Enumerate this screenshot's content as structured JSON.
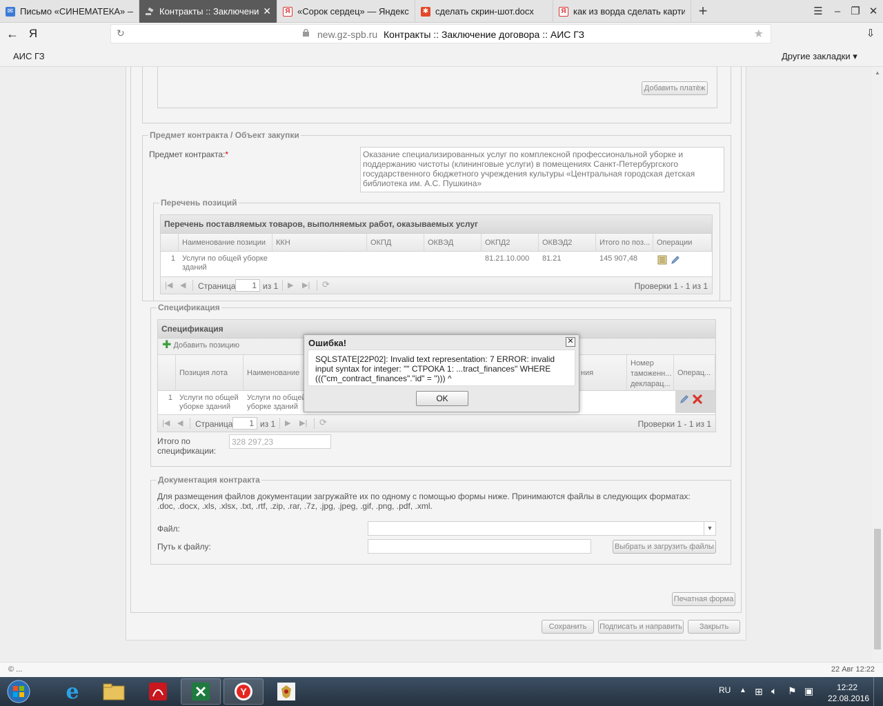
{
  "browser": {
    "tabs": [
      {
        "label": "Письмо «СИНЕМАТЕКА» —",
        "icon": "mail-icon"
      },
      {
        "label": "Контракты :: Заключение",
        "icon": "gavel-icon"
      },
      {
        "label": "«Сорок сердец» — Яндекс",
        "icon": "yandex-icon"
      },
      {
        "label": "сделать скрин-шот.docx",
        "icon": "document-icon"
      },
      {
        "label": "как из ворда сделать карти",
        "icon": "yandex-icon"
      }
    ],
    "new_tab": "+",
    "yandex_logo": "Я",
    "address": {
      "host": "new.gz-spb.ru",
      "page_title": "Контракты :: Заключение договора :: АИС ГЗ"
    },
    "bookmarks": {
      "left": "АИС ГЗ",
      "right": "Другие закладки ▾"
    }
  },
  "form": {
    "add_payment_button": "Добавить платёж",
    "subject": {
      "legend": "Предмет контракта / Объект закупки",
      "label": "Предмет контракта:",
      "required": "*",
      "value": "Оказание специализированных услуг по комплексной профессиональной уборке и поддержанию чистоты (клининговые услуги) в помещениях Санкт-Петербургского государственного бюджетного учреждения культуры «Центральная городская детская библиотека им. А.С. Пушкина»"
    },
    "positions": {
      "legend": "Перечень позиций",
      "grid_title": "Перечень поставляемых товаров, выполняемых работ, оказываемых услуг",
      "columns": [
        "Наименование позиции",
        "ККН",
        "ОКПД",
        "ОКВЭД",
        "ОКПД2",
        "ОКВЭД2",
        "Итого по поз...",
        "Операции"
      ],
      "row": {
        "num": "1",
        "name": "Услуги по общей уборке зданий",
        "okpd2": "81.21.10.000",
        "okved2": "81.21",
        "total": "145 907,48"
      },
      "pager": {
        "page_label": "Страница",
        "page": "1",
        "of": "из 1",
        "info": "Проверки 1 - 1 из 1"
      }
    },
    "specification": {
      "legend": "Спецификация",
      "grid_title": "Спецификация",
      "add_position": "Добавить позицию",
      "columns": [
        "Позиция лота",
        "Наименование",
        "ния",
        "Номер таможенн... декларац...",
        "Операц..."
      ],
      "row": {
        "num": "1",
        "lot": "Услуги по общей уборке зданий",
        "name": "Услуги по общей уборке зданий"
      },
      "pager": {
        "page_label": "Страница",
        "page": "1",
        "of": "из 1",
        "info": "Проверки 1 - 1 из 1"
      },
      "total_label": "Итого по спецификации:",
      "total_value": "328 297,23"
    },
    "documentation": {
      "legend": "Документация контракта",
      "info": "Для размещения файлов документации загружайте их по одному с помощью формы ниже. Принимаются файлы в следующих форматах: .doc, .docx, .xls, .xlsx, .txt, .rtf, .zip, .rar, .7z, .jpg, .jpeg, .gif, .png, .pdf, .xml.",
      "file_label": "Файл:",
      "path_label": "Путь к файлу:",
      "upload_button": "Выбрать и загрузить файлы"
    },
    "print_button": "Печатная форма",
    "save_button": "Сохранить",
    "sign_button": "Подписать и направить",
    "close_button": "Закрыть"
  },
  "dialog": {
    "title": "Ошибка!",
    "message": "SQLSTATE[22P02]: Invalid text representation: 7 ERROR: invalid input syntax for integer: \"\" СТРОКА 1: ...tract_finances\" WHERE (((\"cm_contract_finances\".\"id\" = ''))) ^",
    "ok": "OK"
  },
  "status": {
    "left": "© ...",
    "right": "22 Авг 12:22"
  },
  "taskbar": {
    "lang": "RU",
    "time": "12:22",
    "date": "22.08.2016"
  },
  "colors": {
    "page_bg": "#eeeeee",
    "active_tab": "#5a5a5a",
    "error_red": "#cc0000",
    "taskbar": "#2c3a48"
  }
}
